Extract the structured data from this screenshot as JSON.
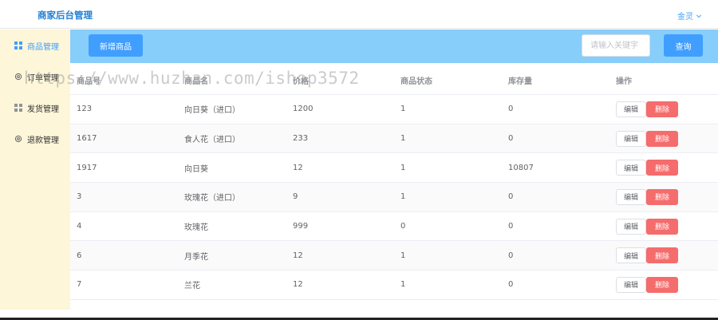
{
  "header": {
    "title": "商家后台管理",
    "user": "金灵"
  },
  "sidebar": {
    "items": [
      {
        "label": "商品管理",
        "icon": "grid-icon",
        "active": true
      },
      {
        "label": "订单管理",
        "icon": "gear-icon",
        "active": false
      },
      {
        "label": "发货管理",
        "icon": "grid-icon",
        "active": false
      },
      {
        "label": "退款管理",
        "icon": "gear-icon",
        "active": false
      }
    ]
  },
  "toolbar": {
    "add_label": "新增商品",
    "search_placeholder": "请输入关键字",
    "search_label": "查询"
  },
  "table": {
    "columns": [
      "商品号",
      "商品名",
      "价格",
      "商品状态",
      "库存量",
      "操作"
    ],
    "rows": [
      [
        "123",
        "向日葵（进口）",
        "1200",
        "1",
        "0"
      ],
      [
        "1617",
        "食人花（进口）",
        "233",
        "1",
        "0"
      ],
      [
        "1917",
        "向日葵",
        "12",
        "1",
        "10807"
      ],
      [
        "3",
        "玫瑰花（进口）",
        "9",
        "1",
        "0"
      ],
      [
        "4",
        "玫瑰花",
        "999",
        "0",
        "0"
      ],
      [
        "6",
        "月季花",
        "12",
        "1",
        "0"
      ],
      [
        "7",
        "兰花",
        "12",
        "1",
        "0"
      ]
    ],
    "edit_label": "编辑",
    "delete_label": "删除"
  },
  "watermark": "https://www.huzhan.com/ishop3572",
  "colors": {
    "brand": "#1f7fd6",
    "primary": "#409eff",
    "toolbar": "#87cefa",
    "sidebar": "#fdf6d8",
    "danger": "#f56c6c"
  }
}
